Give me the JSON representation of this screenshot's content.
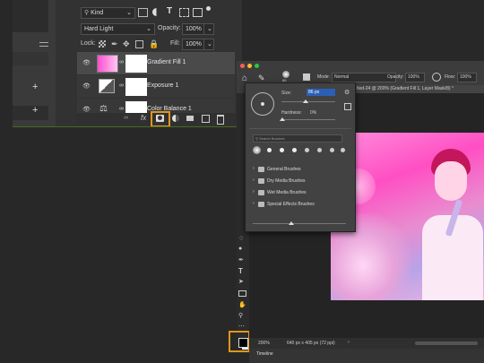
{
  "layers_panel": {
    "filter_kind": "Kind",
    "blend_mode": "Hard Light",
    "opacity_label": "Opacity:",
    "opacity_value": "100%",
    "lock_label": "Lock:",
    "fill_label": "Fill:",
    "fill_value": "100%",
    "layers": [
      {
        "name": "Gradient Fill 1"
      },
      {
        "name": "Exposure 1"
      },
      {
        "name": "Color Balance 1"
      }
    ],
    "footer_fx": "fx"
  },
  "options_bar": {
    "brush_size": "86",
    "mode_label": "Mode:",
    "mode_value": "Normal",
    "opacity_label": "Opacity:",
    "opacity_value": "100%",
    "flow_label": "Flow:",
    "flow_value": "100%"
  },
  "document": {
    "tab_title": "tled-24 @ 200% (Gradient Fill 1, Layer Mask/8) *",
    "zoom": "200%",
    "dimensions": "640 px x 405 px (72 ppi)",
    "timeline_label": "Timeline"
  },
  "brush_picker": {
    "size_label": "Size:",
    "size_value": "86 px",
    "hardness_label": "Hardness:",
    "hardness_value": "0%",
    "search_placeholder": "Search Brushes",
    "folders": [
      "General Brushes",
      "Dry Media Brushes",
      "Wet Media Brushes",
      "Special Effects Brushes"
    ]
  },
  "colors": {
    "highlight": "#e0961c",
    "accent_blue": "#2e6fe0",
    "pink_tint": "#ff5fc8"
  }
}
